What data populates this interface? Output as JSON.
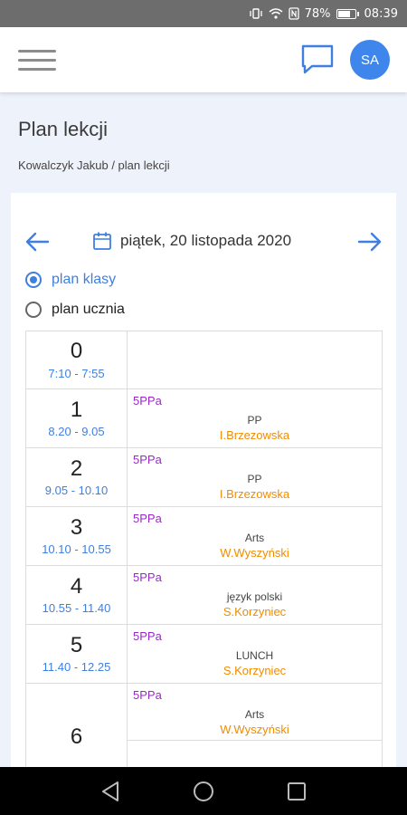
{
  "status_bar": {
    "battery": "78%",
    "time": "08:39",
    "battery_level": 0.78
  },
  "header": {
    "avatar_initials": "SA"
  },
  "page": {
    "title": "Plan lekcji",
    "breadcrumb": "Kowalczyk Jakub / plan lekcji"
  },
  "date_nav": {
    "date": "piątek, 20 listopada 2020"
  },
  "view_options": [
    {
      "label": "plan klasy",
      "selected": true
    },
    {
      "label": "plan ucznia",
      "selected": false
    }
  ],
  "colors": {
    "accent": "#3f7fe0",
    "class_code": "#9a28c9",
    "teacher": "#f08c00"
  },
  "timetable": [
    {
      "num": "0",
      "time": "7:10 - 7:55"
    },
    {
      "num": "1",
      "time": "8.20 - 9.05",
      "class": "5PPa",
      "subject": "PP",
      "teacher": "I.Brzezowska"
    },
    {
      "num": "2",
      "time": "9.05 - 10.10",
      "class": "5PPa",
      "subject": "PP",
      "teacher": "I.Brzezowska"
    },
    {
      "num": "3",
      "time": "10.10 - 10.55",
      "class": "5PPa",
      "subject": "Arts",
      "teacher": "W.Wyszyński"
    },
    {
      "num": "4",
      "time": "10.55 - 11.40",
      "class": "5PPa",
      "subject": "język polski",
      "teacher": "S.Korzyniec"
    },
    {
      "num": "5",
      "time": "11.40 - 12.25",
      "class": "5PPa",
      "subject": "LUNCH",
      "teacher": "S.Korzyniec"
    },
    {
      "num": "6",
      "time": "",
      "class": "5PPa",
      "subject": "Arts",
      "teacher": "W.Wyszyński"
    }
  ]
}
